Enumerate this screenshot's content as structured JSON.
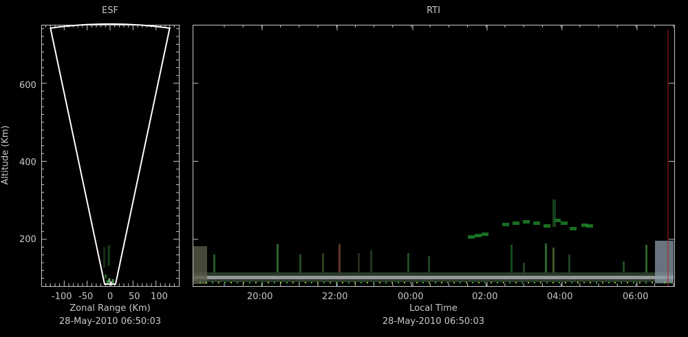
{
  "chart_data": [
    {
      "type": "scatter",
      "title": "ESF",
      "xlabel": "Zonal Range (Km)",
      "ylabel": "Altitude (Km)",
      "timestamp": "28-May-2010 06:50:03",
      "xlim": [
        -150,
        150
      ],
      "ylim": [
        80,
        750
      ],
      "x_ticks": [
        "-100",
        "-50",
        "0",
        "50",
        "100"
      ],
      "x_tick_values": [
        -100,
        -50,
        0,
        50,
        100
      ],
      "y_ticks": [
        "200",
        "400",
        "600"
      ],
      "y_tick_values": [
        200,
        400,
        600
      ],
      "fan": {
        "apex_alt": 85,
        "top_alt": 745,
        "half_width_at_top": 130
      }
    },
    {
      "type": "heatmap",
      "title": "RTI",
      "xlabel": "Local Time",
      "ylabel": "Altitude (Km)",
      "timestamp": "28-May-2010 06:50:03",
      "ylim": [
        80,
        750
      ],
      "x_ticks": [
        "20:00",
        "22:00",
        "00:00",
        "02:00",
        "04:00",
        "06:00"
      ],
      "y_ticks": [
        "200",
        "400",
        "600"
      ],
      "y_tick_values": [
        200,
        400,
        600
      ],
      "echo_bands": [
        {
          "name": "bottom-layer",
          "alt_range": [
            90,
            105
          ],
          "time_range": [
            "18:15",
            "06:50"
          ],
          "color": "#c8c8c8"
        },
        {
          "name": "plume",
          "alt_range": [
            220,
            260
          ],
          "time_range": [
            "01:40",
            "04:45"
          ],
          "color": "#1f8a2a"
        }
      ]
    }
  ]
}
